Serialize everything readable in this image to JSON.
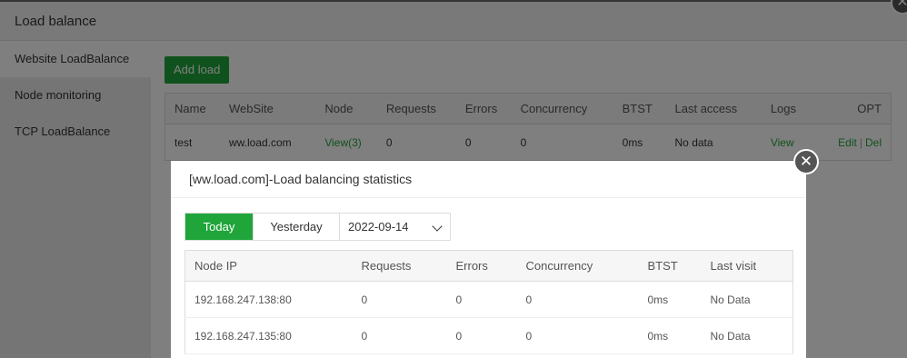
{
  "base": {
    "title": "Load balance",
    "close_glyph": "✕",
    "sidebar": {
      "items": [
        {
          "label": "Website LoadBalance",
          "active": true
        },
        {
          "label": "Node monitoring",
          "active": false
        },
        {
          "label": "TCP LoadBalance",
          "active": false
        }
      ]
    },
    "add_button": "Add load",
    "table": {
      "headers": [
        "Name",
        "WebSite",
        "Node",
        "Requests",
        "Errors",
        "Concurrency",
        "BTST",
        "Last access",
        "Logs",
        "OPT"
      ],
      "row": {
        "name": "test",
        "website": "ww.load.com",
        "node": "View(3)",
        "requests": "0",
        "errors": "0",
        "concurrency": "0",
        "btst": "0ms",
        "last_access": "No data",
        "logs": "View",
        "edit": "Edit",
        "sep": "|",
        "del": "Del"
      }
    }
  },
  "popup": {
    "title": "[ww.load.com]-Load balancing statistics",
    "close_glyph": "✕",
    "tabs": {
      "today": "Today",
      "yesterday": "Yesterday",
      "date": "2022-09-14"
    },
    "table": {
      "headers": [
        "Node IP",
        "Requests",
        "Errors",
        "Concurrency",
        "BTST",
        "Last visit"
      ],
      "rows": [
        [
          "192.168.247.138:80",
          "0",
          "0",
          "0",
          "0ms",
          "No Data"
        ],
        [
          "192.168.247.135:80",
          "0",
          "0",
          "0",
          "0ms",
          "No Data"
        ]
      ]
    }
  },
  "colors": {
    "accent": "#20a53a",
    "overlay": "rgba(0,0,0,0.5)"
  }
}
